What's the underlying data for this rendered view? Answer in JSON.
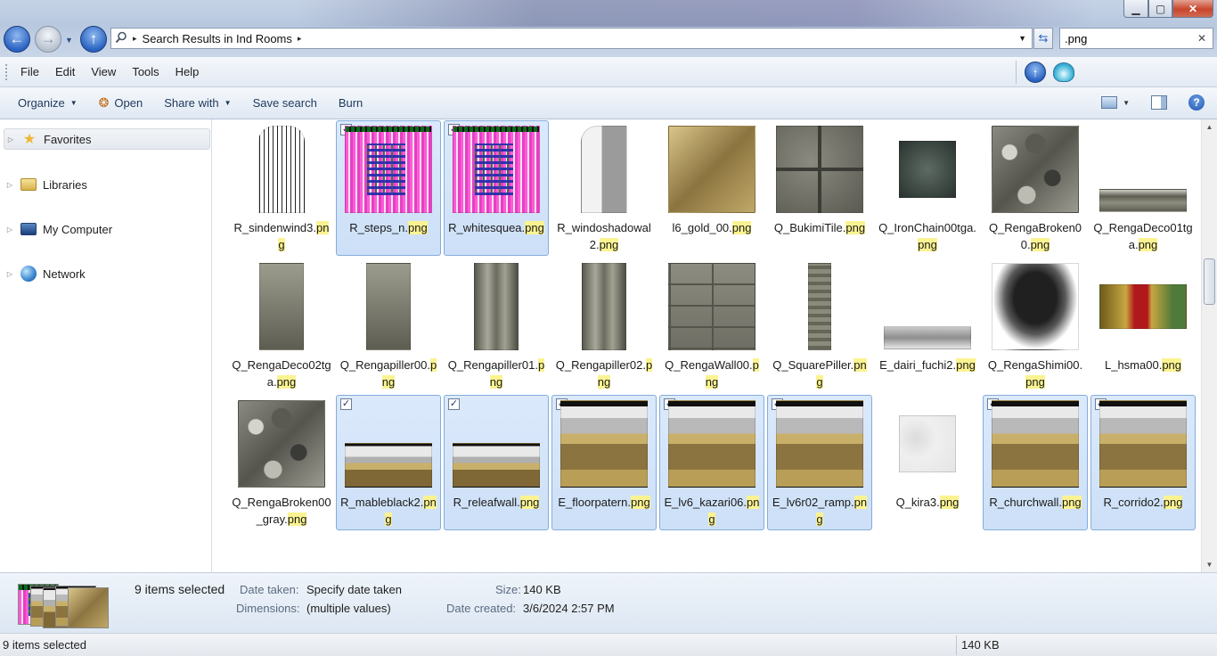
{
  "window": {
    "controls": {
      "minimize": "▁",
      "maximize": "▢",
      "close": "✕"
    }
  },
  "navigation": {
    "back": "←",
    "forward": "→",
    "up": "↑",
    "history_dropdown": "▼"
  },
  "address": {
    "breadcrumb": "Search Results in Ind Rooms",
    "separator": "▸",
    "dropdown": "▼"
  },
  "search": {
    "value": ".png",
    "clear_label": "✕"
  },
  "menu": {
    "items": [
      {
        "label": "File"
      },
      {
        "label": "Edit"
      },
      {
        "label": "View"
      },
      {
        "label": "Tools"
      },
      {
        "label": "Help"
      }
    ]
  },
  "commands": {
    "organize": "Organize",
    "open": "Open",
    "share_with": "Share with",
    "save_search": "Save search",
    "burn": "Burn",
    "dropdown_arrow": "▼"
  },
  "nav_pane": {
    "items": [
      {
        "label": "Favorites",
        "icon": "star-icon"
      },
      {
        "label": "Libraries",
        "icon": "libraries-icon"
      },
      {
        "label": "My Computer",
        "icon": "computer-icon"
      },
      {
        "label": "Network",
        "icon": "network-icon"
      }
    ],
    "expander": "▷"
  },
  "files": [
    {
      "name": "R_sindenwind3.",
      "ext": "png",
      "selected": false,
      "thumb": "window"
    },
    {
      "name": "R_steps_n.",
      "ext": "png",
      "selected": true,
      "thumb": "pinkglitch"
    },
    {
      "name": "R_whitesquea.",
      "ext": "png",
      "selected": true,
      "thumb": "pinkglitch"
    },
    {
      "name": "R_windoshadowal2.",
      "ext": "png",
      "selected": false,
      "thumb": "window-shadow"
    },
    {
      "name": "l6_gold_00.",
      "ext": "png",
      "selected": false,
      "thumb": "gold"
    },
    {
      "name": "Q_BukimiTile.",
      "ext": "png",
      "selected": false,
      "thumb": "stone-tile"
    },
    {
      "name": "Q_IronChain00tga.",
      "ext": "png",
      "selected": false,
      "thumb": "chain"
    },
    {
      "name": "Q_RengaBroken00.",
      "ext": "png",
      "selected": false,
      "thumb": "granite"
    },
    {
      "name": "Q_RengaDeco01tga.",
      "ext": "png",
      "selected": false,
      "thumb": "renga-deco01"
    },
    {
      "name": "Q_RengaDeco02tga.",
      "ext": "png",
      "selected": false,
      "thumb": "deco"
    },
    {
      "name": "Q_Rengapiller00.",
      "ext": "png",
      "selected": false,
      "thumb": "deco"
    },
    {
      "name": "Q_Rengapiller01.",
      "ext": "png",
      "selected": false,
      "thumb": "pillar"
    },
    {
      "name": "Q_Rengapiller02.",
      "ext": "png",
      "selected": false,
      "thumb": "pillar"
    },
    {
      "name": "Q_RengaWall00.",
      "ext": "png",
      "selected": false,
      "thumb": "stone-brick"
    },
    {
      "name": "Q_SquarePiller.",
      "ext": "png",
      "selected": false,
      "thumb": "sq-pillar"
    },
    {
      "name": "E_dairi_fuchi2.",
      "ext": "png",
      "selected": false,
      "thumb": "dairi"
    },
    {
      "name": "Q_RengaShimi00.",
      "ext": "png",
      "selected": false,
      "thumb": "shimi"
    },
    {
      "name": "L_hsma00.",
      "ext": "png",
      "selected": false,
      "thumb": "hsma"
    },
    {
      "name": "Q_RengaBroken00_gray.",
      "ext": "png",
      "selected": false,
      "thumb": "granite"
    },
    {
      "name": "R_mableblack2.",
      "ext": "png",
      "selected": true,
      "thumb": "marblegold2"
    },
    {
      "name": "R_releafwall.",
      "ext": "png",
      "selected": true,
      "thumb": "marblegold2"
    },
    {
      "name": "E_floorpatern.",
      "ext": "png",
      "selected": true,
      "thumb": "marblegold"
    },
    {
      "name": "E_lv6_kazari06.",
      "ext": "png",
      "selected": true,
      "thumb": "marblegold"
    },
    {
      "name": "E_lv6r02_ramp.",
      "ext": "png",
      "selected": true,
      "thumb": "marblegold"
    },
    {
      "name": "Q_kira3.",
      "ext": "png",
      "selected": false,
      "thumb": "kira"
    },
    {
      "name": "R_churchwall.",
      "ext": "png",
      "selected": true,
      "thumb": "marblegold"
    },
    {
      "name": "R_corrido2.",
      "ext": "png",
      "selected": true,
      "thumb": "marblegold"
    }
  ],
  "details": {
    "selection_count": "9 items selected",
    "date_taken_label": "Date taken:",
    "date_taken_value": "Specify date taken",
    "dimensions_label": "Dimensions:",
    "dimensions_value": "(multiple values)",
    "size_label": "Size:",
    "size_value": "140 KB",
    "date_created_label": "Date created:",
    "date_created_value": "3/6/2024 2:57 PM"
  },
  "status": {
    "left": "9 items selected",
    "right": "140 KB"
  },
  "checkmark": "✓"
}
